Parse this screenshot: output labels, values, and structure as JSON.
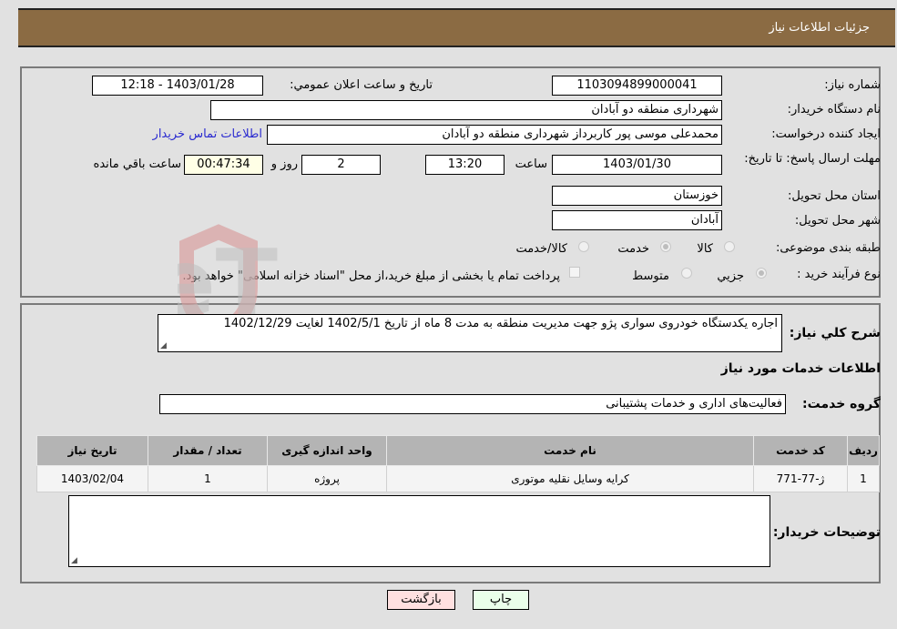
{
  "header": {
    "title": "جزئیات اطلاعات نیاز"
  },
  "fields": {
    "need_number_label": "شماره نیاز:",
    "need_number": "1103094899000041",
    "announce_label": "تاریخ و ساعت اعلان عمومي:",
    "announce_value": "1403/01/28 - 12:18",
    "buyer_org_label": "نام دستگاه خریدار:",
    "buyer_org": "شهرداری منطقه دو آبادان",
    "creator_label": "ایجاد کننده درخواست:",
    "creator": "محمدعلی موسی پور کاربرداز شهرداری منطقه دو آبادان",
    "contact_link": "اطلاعات تماس خریدار",
    "deadline_label": "مهلت ارسال پاسخ: تا تاریخ:",
    "deadline_date": "1403/01/30",
    "time_label": "ساعت",
    "deadline_time": "13:20",
    "days_value": "2",
    "days_label": "روز و",
    "remaining_time": "00:47:34",
    "remaining_label": "ساعت باقي مانده",
    "province_label": "استان محل تحویل:",
    "province": "خوزستان",
    "city_label": "شهر محل تحویل:",
    "city": "آبادان",
    "category_label": "طبقه بندی موضوعی:",
    "category_options": [
      {
        "label": "کالا",
        "checked": false
      },
      {
        "label": "خدمت",
        "checked": true
      },
      {
        "label": "کالا/خدمت",
        "checked": false
      }
    ],
    "process_label": "نوع فرآیند خرید :",
    "process_options": [
      {
        "label": "جزيي",
        "checked": true
      },
      {
        "label": "متوسط",
        "checked": false
      }
    ],
    "treasury_checkbox_label": "پرداخت تمام یا بخشی از مبلغ خرید،از محل \"اسناد خزانه اسلامی\" خواهد بود.",
    "treasury_checked": false
  },
  "details": {
    "description_label": "شرح کلي نیاز:",
    "description": "اجاره یکدستگاه خودروی سواری پژو جهت مدیریت منطقه به مدت 8 ماه از تاریخ 1402/5/1 لغایت 1402/12/29",
    "services_heading": "اطلاعات خدمات مورد نیاز",
    "service_group_label": "گروه خدمت:",
    "service_group": "فعالیت‌های اداری و خدمات پشتیبانی",
    "table": {
      "headers": [
        "ردیف",
        "کد خدمت",
        "نام خدمت",
        "واحد اندازه گیری",
        "تعداد / مقدار",
        "تاریخ نیاز"
      ],
      "rows": [
        [
          "1",
          "ژ-77-771",
          "کرایه وسایل نقلیه موتوری",
          "پروژه",
          "1",
          "1403/02/04"
        ]
      ]
    },
    "buyer_notes_label": "توضیحات خریدار:",
    "buyer_notes": ""
  },
  "buttons": {
    "print": "چاپ",
    "back": "بازگشت"
  },
  "watermark": {
    "text": "AriaTender.neT"
  },
  "colors": {
    "header_bg": "#8b6b43",
    "print_bg": "#eaffea",
    "back_bg": "#ffe0e0",
    "link": "#2a2ad0"
  }
}
